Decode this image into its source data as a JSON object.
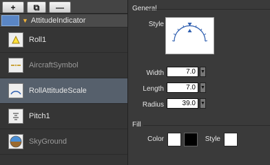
{
  "toolbar": {
    "add_label": "+",
    "copy_label": "⧉",
    "remove_label": "—"
  },
  "tree": {
    "root": "AttitudeIndicator",
    "items": [
      {
        "label": "Roll1",
        "state": "normal"
      },
      {
        "label": "AircraftSymbol",
        "state": "dim"
      },
      {
        "label": "RollAttitudeScale",
        "state": "selected"
      },
      {
        "label": "Pitch1",
        "state": "normal"
      },
      {
        "label": "SkyGround",
        "state": "dim"
      }
    ]
  },
  "general": {
    "section_title": "General",
    "style_label": "Style",
    "width_label": "Width",
    "width_value": "7.0",
    "length_label": "Length",
    "length_value": "7.0",
    "radius_label": "Radius",
    "radius_value": "39.0"
  },
  "fill": {
    "section_title": "Fill",
    "color_label": "Color",
    "style_label": "Style",
    "colors": {
      "left": "#ffffff",
      "right": "#000000",
      "style": "#ffffff"
    }
  },
  "colors": {
    "panel_bg": "#3a3a3a",
    "selected_row": "#56606c",
    "root_accent": "#f0b33a"
  }
}
